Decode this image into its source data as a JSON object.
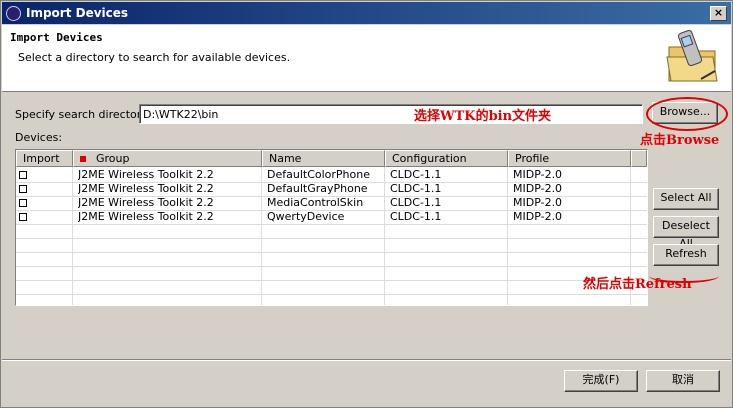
{
  "window": {
    "title": "Import Devices",
    "close_glyph": "×"
  },
  "header": {
    "title": "Import Devices",
    "description": "Select a directory to search for available devices."
  },
  "search": {
    "label": "Specify search directory:",
    "value": "D:\\WTK22\\bin",
    "browse_label": "Browse..."
  },
  "devices_label": "Devices:",
  "table": {
    "columns": [
      "Import",
      "Group",
      "Name",
      "Configuration",
      "Profile"
    ],
    "rows": [
      {
        "group": "J2ME Wireless Toolkit 2.2",
        "name": "DefaultColorPhone",
        "configuration": "CLDC-1.1",
        "profile": "MIDP-2.0"
      },
      {
        "group": "J2ME Wireless Toolkit 2.2",
        "name": "DefaultGrayPhone",
        "configuration": "CLDC-1.1",
        "profile": "MIDP-2.0"
      },
      {
        "group": "J2ME Wireless Toolkit 2.2",
        "name": "MediaControlSkin",
        "configuration": "CLDC-1.1",
        "profile": "MIDP-2.0"
      },
      {
        "group": "J2ME Wireless Toolkit 2.2",
        "name": "QwertyDevice",
        "configuration": "CLDC-1.1",
        "profile": "MIDP-2.0"
      }
    ]
  },
  "side_buttons": {
    "select_all": "Select All",
    "deselect_all": "Deselect All",
    "refresh": "Refresh"
  },
  "footer": {
    "finish": "完成(F)",
    "cancel": "取消"
  },
  "annotations": {
    "select_folder": "选择WTK的bin文件夹",
    "click_browse": "点击Browse",
    "then_refresh": "然后点击Refresh"
  },
  "colors": {
    "title_bar": "#0a246a",
    "annotation": "#e00000",
    "dialog_bg": "#d4d0c8"
  }
}
